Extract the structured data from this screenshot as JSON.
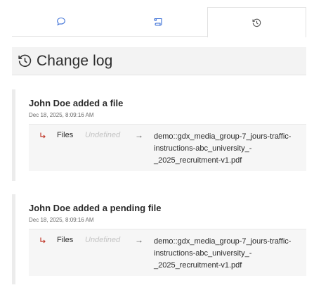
{
  "tabs": [
    {
      "icon": "chat-bubble-icon",
      "active": false
    },
    {
      "icon": "scroll-icon",
      "active": false
    },
    {
      "icon": "history-icon",
      "active": true
    }
  ],
  "header": {
    "title": "Change log",
    "icon": "history-icon"
  },
  "entries": [
    {
      "title": "John Doe added a file",
      "timestamp": "Dec 18, 2025, 8:09:16 AM",
      "change": {
        "field": "Files",
        "old_value": "Undefined",
        "arrow": "→",
        "new_value": "demo::gdx_media_group-7_jours-traffic-instructions-abc_university_-_2025_recruitment-v1.pdf"
      }
    },
    {
      "title": "John Doe added a pending file",
      "timestamp": "Dec 18, 2025, 8:09:16 AM",
      "change": {
        "field": "Files",
        "old_value": "Undefined",
        "arrow": "→",
        "new_value": "demo::gdx_media_group-7_jours-traffic-instructions-abc_university_-_2025_recruitment-v1.pdf"
      }
    }
  ],
  "colors": {
    "change_icon": "#c0392b",
    "accent_border": "#ececec"
  }
}
